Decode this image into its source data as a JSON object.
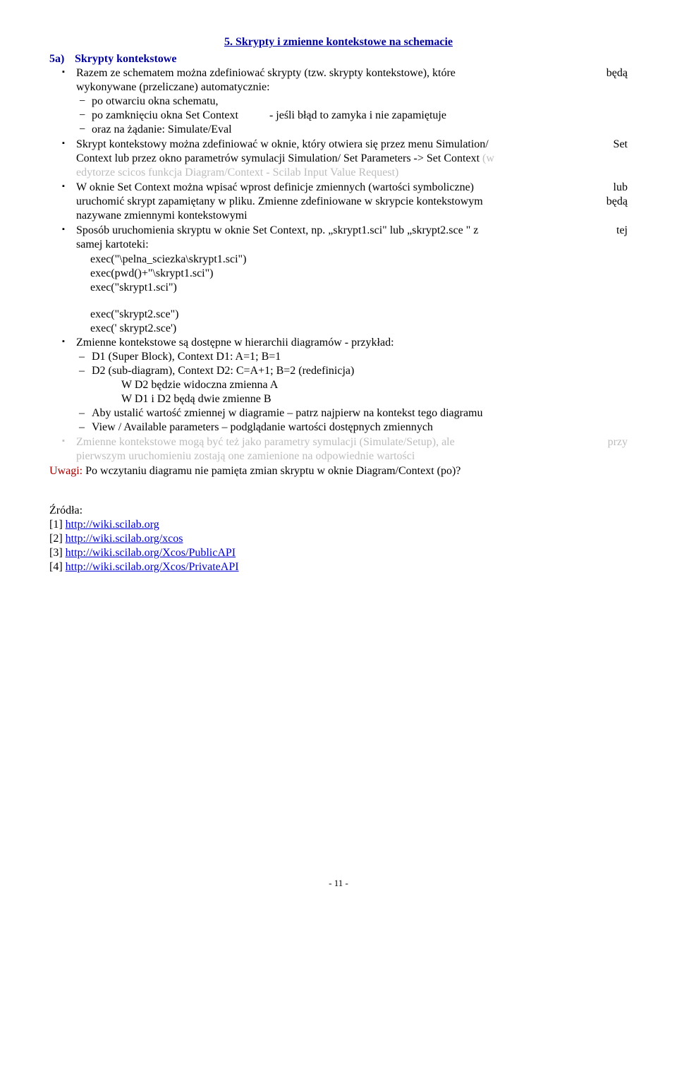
{
  "title": "5. Skrypty i zmienne kontekstowe na schemacie",
  "sec5a_num": "5a)",
  "sec5a_title": "Skrypty kontekstowe",
  "b1_a": "Razem ze schematem można zdefiniować skrypty (tzw. skrypty kontekstowe), które będą",
  "b1_b": "wykonywane (przeliczane) automatycznie:",
  "b1_d1": "po otwarciu okna schematu,",
  "b1_d2a": "po zamknięciu okna Set Context",
  "b1_d2b": "- jeśli błąd to zamyka i nie zapamiętuje",
  "b1_d3": "oraz na żądanie: Simulate/Eval",
  "b2_a": "Skrypt kontekstowy można zdefiniować w oknie, który otwiera się przez menu Simulation/ Set",
  "b2_b": "Context lub przez okno parametrów symulacji Simulation/ Set Parameters -> Set Context ",
  "b2_m1": "(w",
  "b2_m2": "edytorze scicos funkcja Diagram/Context - Scilab Input Value Request)",
  "b3_a": "W oknie Set Context można wpisać wprost definicje zmiennych (wartości symboliczne) lub",
  "b3_b": "uruchomić skrypt zapamiętany w pliku. Zmienne zdefiniowane w skrypcie kontekstowym będą",
  "b3_c": "nazywane zmiennymi kontekstowymi",
  "b4_a": "Sposób uruchomienia skryptu w oknie Set Context, np. „skrypt1.sci\" lub „skrypt2.sce \" z tej",
  "b4_b": "samej kartoteki:",
  "exec1": "exec(\"\\pelna_sciezka\\skrypt1.sci\")",
  "exec2": "exec(pwd()+\"\\skrypt1.sci\")",
  "exec3": "exec(\"skrypt1.sci\")",
  "exec4": "exec(\"skrypt2.sce\")",
  "exec5": "exec(' skrypt2.sce')",
  "b5": "Zmienne kontekstowe są dostępne w hierarchii diagramów - przykład:",
  "d5_1": "D1 (Super Block), Context D1: A=1; B=1",
  "d5_2": "D2 (sub-diagram), Context D2: C=A+1; B=2 (redefinicja)",
  "d5_2a": "W D2 będzie widoczna zmienna A",
  "d5_2b": "W D1 i D2 będą dwie zmienne B",
  "d5_3": "Aby ustalić wartość zmiennej w diagramie – patrz najpierw na kontekst tego diagramu",
  "d5_4": "View / Available parameters – podglądanie wartości dostępnych zmiennych",
  "b6_a": "Zmienne kontekstowe mogą być też jako parametry symulacji (Simulate/Setup), ale przy",
  "b6_b": "pierwszym uruchomieniu zostają one zamienione na odpowiednie wartości",
  "uwagi": "Uwagi:",
  "uwagi_t": " Po wczytaniu diagramu nie pamięta zmian skryptu w oknie Diagram/Context (po)?",
  "src_h": "Źródła:",
  "s1p": "[1] ",
  "s1": "http://wiki.scilab.org",
  "s2p": "[2] ",
  "s2": "http://wiki.scilab.org/xcos",
  "s3p": "[3] ",
  "s3": "http://wiki.scilab.org/Xcos/PublicAPI",
  "s4p": "[4] ",
  "s4": "http://wiki.scilab.org/Xcos/PrivateAPI",
  "pg": "- 11 -"
}
